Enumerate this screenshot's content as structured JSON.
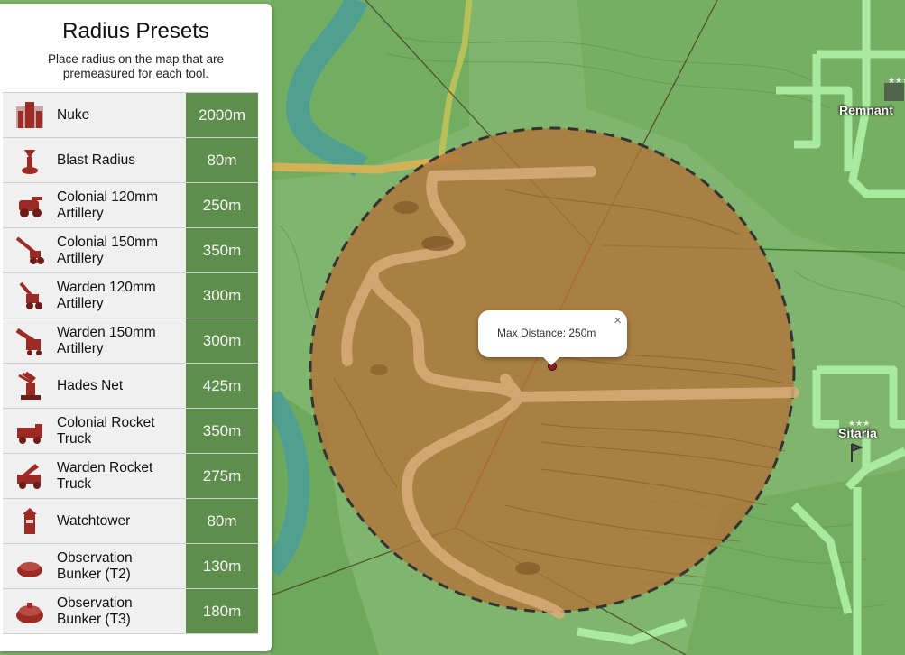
{
  "panel": {
    "title": "Radius Presets",
    "subtitle": "Place radius on the map that are premeasured for each tool."
  },
  "presets": [
    {
      "label": "Nuke",
      "value": "2000m",
      "icon": "nuke-icon"
    },
    {
      "label": "Blast Radius",
      "value": "80m",
      "icon": "blast-radius-icon"
    },
    {
      "label": "Colonial 120mm\nArtillery",
      "value": "250m",
      "icon": "colonial-120mm-artillery-icon"
    },
    {
      "label": "Colonial 150mm\nArtillery",
      "value": "350m",
      "icon": "colonial-150mm-artillery-icon"
    },
    {
      "label": "Warden 120mm\nArtillery",
      "value": "300m",
      "icon": "warden-120mm-artillery-icon"
    },
    {
      "label": "Warden 150mm\nArtillery",
      "value": "300m",
      "icon": "warden-150mm-artillery-icon"
    },
    {
      "label": "Hades Net",
      "value": "425m",
      "icon": "hades-net-icon"
    },
    {
      "label": "Colonial Rocket\nTruck",
      "value": "350m",
      "icon": "colonial-rocket-truck-icon"
    },
    {
      "label": "Warden Rocket\nTruck",
      "value": "275m",
      "icon": "warden-rocket-truck-icon"
    },
    {
      "label": "Watchtower",
      "value": "80m",
      "icon": "watchtower-icon"
    },
    {
      "label": "Observation\nBunker (T2)",
      "value": "130m",
      "icon": "observation-bunker-t2-icon"
    },
    {
      "label": "Observation\nBunker (T3)",
      "value": "180m",
      "icon": "observation-bunker-t3-icon"
    }
  ],
  "popup": {
    "text": "Max Distance: 250m",
    "close": "×"
  },
  "towns": [
    {
      "name": "Remnant"
    },
    {
      "name": "Sitaria"
    }
  ],
  "colors": {
    "radius_fill": "#b0743a",
    "value_cell": "#5e8e4c",
    "map_green": "#7fb56c",
    "road": "#a8eba0",
    "icon_red": "#9c2b26"
  }
}
